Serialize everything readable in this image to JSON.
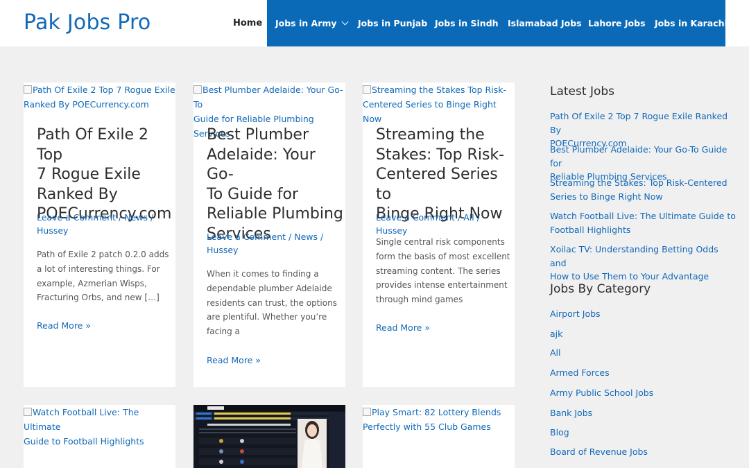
{
  "header": {
    "logo": "Pak Jobs Pro",
    "nav": {
      "home": "Home",
      "army": "Jobs in Army",
      "punjab": "Jobs in Punjab",
      "sindh": "Jobs in Sindh",
      "islamabad": "Islamabad Jobs",
      "lahore": "Lahore Jobs",
      "karachi": "Jobs in Karachi"
    }
  },
  "colors": {
    "brand": "#1169b8",
    "nav_bg": "#0a6ab8",
    "page_bg": "#f0f0f0"
  },
  "posts": [
    {
      "image_alt": [
        "Path Of Exile 2 Top 7 Rogue Exile",
        "Ranked By POECurrency.com"
      ],
      "title": [
        "Path Of Exile 2 Top",
        "7 Rogue Exile",
        "Ranked By",
        "POECurrency.com"
      ],
      "meta": {
        "comment": "Leave a Comment",
        "category": "News",
        "author": "Hussey"
      },
      "excerpt": [
        "Path of Exile 2 patch 0.2.0 adds",
        "a lot of interesting things. For",
        "example, Azmerian Wisps,",
        "Fracturing Orbs, and new […]"
      ],
      "read_more": "Read More »"
    },
    {
      "image_alt": [
        "Best Plumber Adelaide: Your Go-To",
        "Guide for Reliable Plumbing Services"
      ],
      "title": [
        "Best Plumber",
        "Adelaide: Your Go-",
        "To Guide for",
        "Reliable Plumbing",
        "Services"
      ],
      "meta": {
        "comment": "Leave a Comment",
        "category": "News",
        "author": "Hussey"
      },
      "excerpt": [
        "When it comes to finding a",
        "dependable plumber Adelaide",
        "residents can trust, the options",
        "are plentiful. Whether you’re",
        "facing a"
      ],
      "read_more": "Read More »"
    },
    {
      "image_alt": [
        "Streaming the Stakes Top Risk-",
        "Centered Series to Binge Right Now"
      ],
      "title": [
        "Streaming the",
        "Stakes: Top Risk-",
        "Centered Series to",
        "Binge Right Now"
      ],
      "meta": {
        "comment": "Leave a Comment",
        "category": "All",
        "author": "Hussey"
      },
      "excerpt": [
        "Single central risk components",
        "form the basis of most excellent",
        "streaming content. The series",
        "provides intense entertainment",
        "through mind games"
      ],
      "read_more": "Read More »"
    },
    {
      "image_alt": [
        "Watch Football Live: The Ultimate",
        "Guide to Football Highlights"
      ]
    },
    {
      "image_alt": []
    },
    {
      "image_alt": [
        "Play Smart: 82 Lottery Blends",
        "Perfectly with 55 Club Games"
      ]
    }
  ],
  "sidebar": {
    "latest_title": "Latest Jobs",
    "latest": [
      [
        "Path Of Exile 2 Top 7 Rogue Exile Ranked By",
        "POECurrency.com"
      ],
      [
        "Best Plumber Adelaide: Your Go-To Guide for",
        "Reliable Plumbing Services"
      ],
      [
        "Streaming the Stakes: Top Risk-Centered",
        "Series to Binge Right Now"
      ],
      [
        "Watch Football Live: The Ultimate Guide to",
        "Football Highlights"
      ],
      [
        "Xoilac TV: Understanding Betting Odds and",
        "How to Use Them to Your Advantage"
      ]
    ],
    "category_title": "Jobs By Category",
    "categories": [
      "Airport Jobs",
      "ajk",
      "All",
      "Armed Forces",
      "Army Public School Jobs",
      "Bank Jobs",
      "Blog",
      "Board of Revenue Jobs"
    ]
  }
}
